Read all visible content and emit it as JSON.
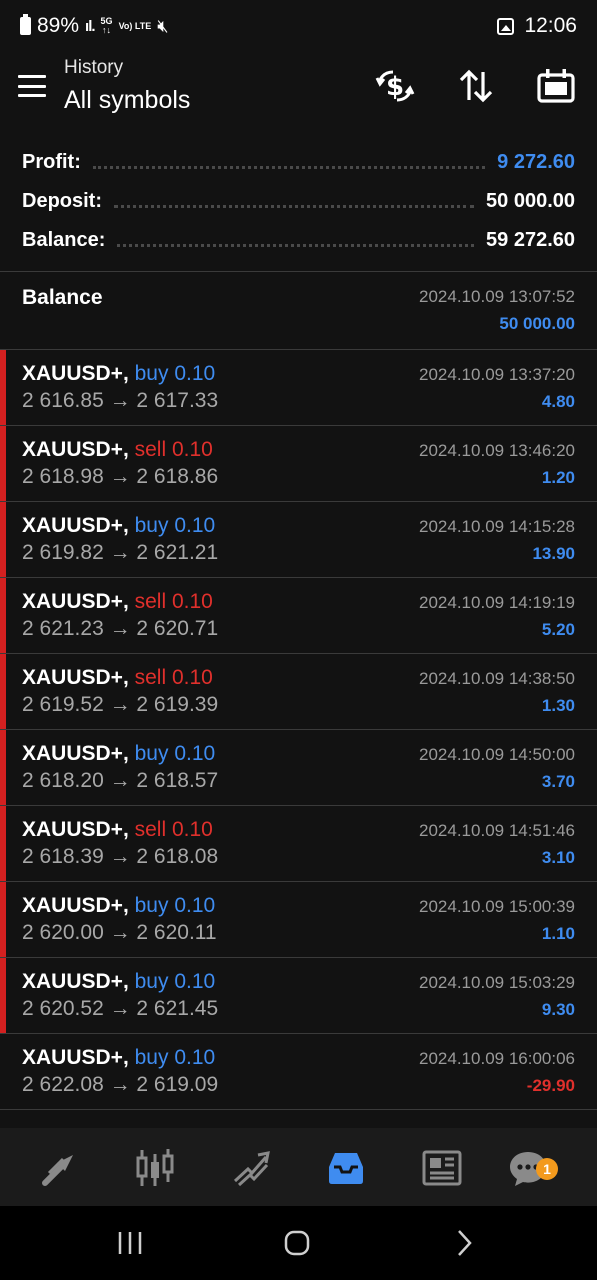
{
  "status": {
    "battery": "89%",
    "network": "5G",
    "volte": "Vo) LTE",
    "time": "12:06"
  },
  "header": {
    "subtitle": "History",
    "title": "All symbols"
  },
  "summary": {
    "profit_label": "Profit:",
    "profit_value": "9 272.60",
    "deposit_label": "Deposit:",
    "deposit_value": "50 000.00",
    "balance_label": "Balance:",
    "balance_value": "59 272.60"
  },
  "balance_entry": {
    "label": "Balance",
    "time": "2024.10.09 13:07:52",
    "amount": "50 000.00"
  },
  "deals": [
    {
      "symbol": "XAUUSD+,",
      "side": "buy 0.10",
      "prices": "2 616.85 → 2 617.33",
      "time": "2024.10.09 13:37:20",
      "profit": "4.80"
    },
    {
      "symbol": "XAUUSD+,",
      "side": "sell 0.10",
      "prices": "2 618.98 → 2 618.86",
      "time": "2024.10.09 13:46:20",
      "profit": "1.20"
    },
    {
      "symbol": "XAUUSD+,",
      "side": "buy 0.10",
      "prices": "2 619.82 → 2 621.21",
      "time": "2024.10.09 14:15:28",
      "profit": "13.90"
    },
    {
      "symbol": "XAUUSD+,",
      "side": "sell 0.10",
      "prices": "2 621.23 → 2 620.71",
      "time": "2024.10.09 14:19:19",
      "profit": "5.20"
    },
    {
      "symbol": "XAUUSD+,",
      "side": "sell 0.10",
      "prices": "2 619.52 → 2 619.39",
      "time": "2024.10.09 14:38:50",
      "profit": "1.30"
    },
    {
      "symbol": "XAUUSD+,",
      "side": "buy 0.10",
      "prices": "2 618.20 → 2 618.57",
      "time": "2024.10.09 14:50:00",
      "profit": "3.70"
    },
    {
      "symbol": "XAUUSD+,",
      "side": "sell 0.10",
      "prices": "2 618.39 → 2 618.08",
      "time": "2024.10.09 14:51:46",
      "profit": "3.10"
    },
    {
      "symbol": "XAUUSD+,",
      "side": "buy 0.10",
      "prices": "2 620.00 → 2 620.11",
      "time": "2024.10.09 15:00:39",
      "profit": "1.10"
    },
    {
      "symbol": "XAUUSD+,",
      "side": "buy 0.10",
      "prices": "2 620.52 → 2 621.45",
      "time": "2024.10.09 15:03:29",
      "profit": "9.30"
    },
    {
      "symbol": "XAUUSD+,",
      "side": "buy 0.10",
      "prices": "2 622.08 → 2 619.09",
      "time": "2024.10.09 16:00:06",
      "profit": "-29.90"
    }
  ],
  "bottom_nav": {
    "chat_badge": "1"
  },
  "colors": {
    "accent_blue": "#3f8cf0",
    "loss_red": "#e0302c",
    "stripe_red": "#d32020",
    "badge_orange": "#f39a1d",
    "background": "#121212"
  }
}
